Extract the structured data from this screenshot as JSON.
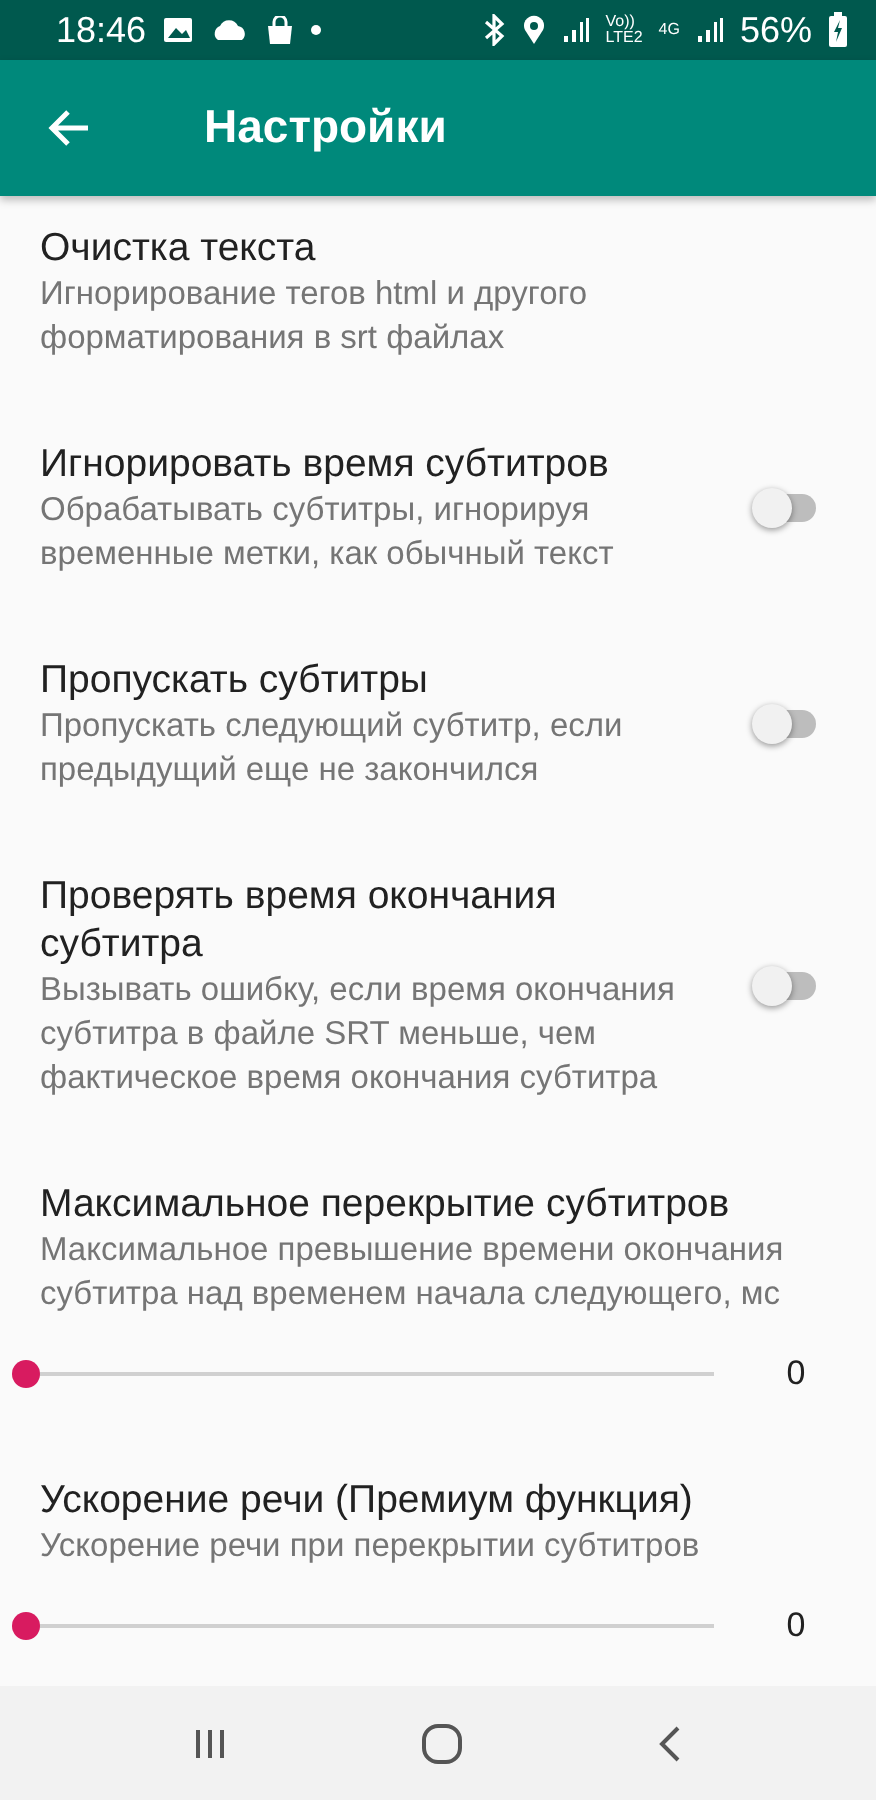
{
  "status_bar": {
    "time": "18:46",
    "volte": "Vo))",
    "lte": "LTE2",
    "network": "4G",
    "battery": "56%"
  },
  "app_bar": {
    "title": "Настройки"
  },
  "settings": [
    {
      "kind": "plain",
      "title": "Очистка текста",
      "summary": "Игнорирование тегов html и другого форматирования в srt файлах"
    },
    {
      "kind": "switch",
      "title": "Игнорировать время субтитров",
      "summary": "Обрабатывать субтитры, игнорируя временные метки, как обычный текст",
      "on": false
    },
    {
      "kind": "switch",
      "title": "Пропускать субтитры",
      "summary": "Пропускать следующий субтитр, если предыдущий еще не закончился",
      "on": false
    },
    {
      "kind": "switch",
      "title": "Проверять время окончания субтитра",
      "summary": "Вызывать ошибку, если время окончания субтитра в файле SRT меньше, чем фактическое время окончания субтитра",
      "on": false
    },
    {
      "kind": "slider",
      "title": "Максимальное перекрытие субтитров",
      "summary": "Максимальное превышение времени окончания субтитра над временем начала следующего, мс",
      "level": 0,
      "value": "0"
    },
    {
      "kind": "slider",
      "title": "Ускорение речи (Премиум функция)",
      "summary": "Ускорение речи при перекрытии субтитров",
      "level": 0,
      "value": "0"
    }
  ]
}
